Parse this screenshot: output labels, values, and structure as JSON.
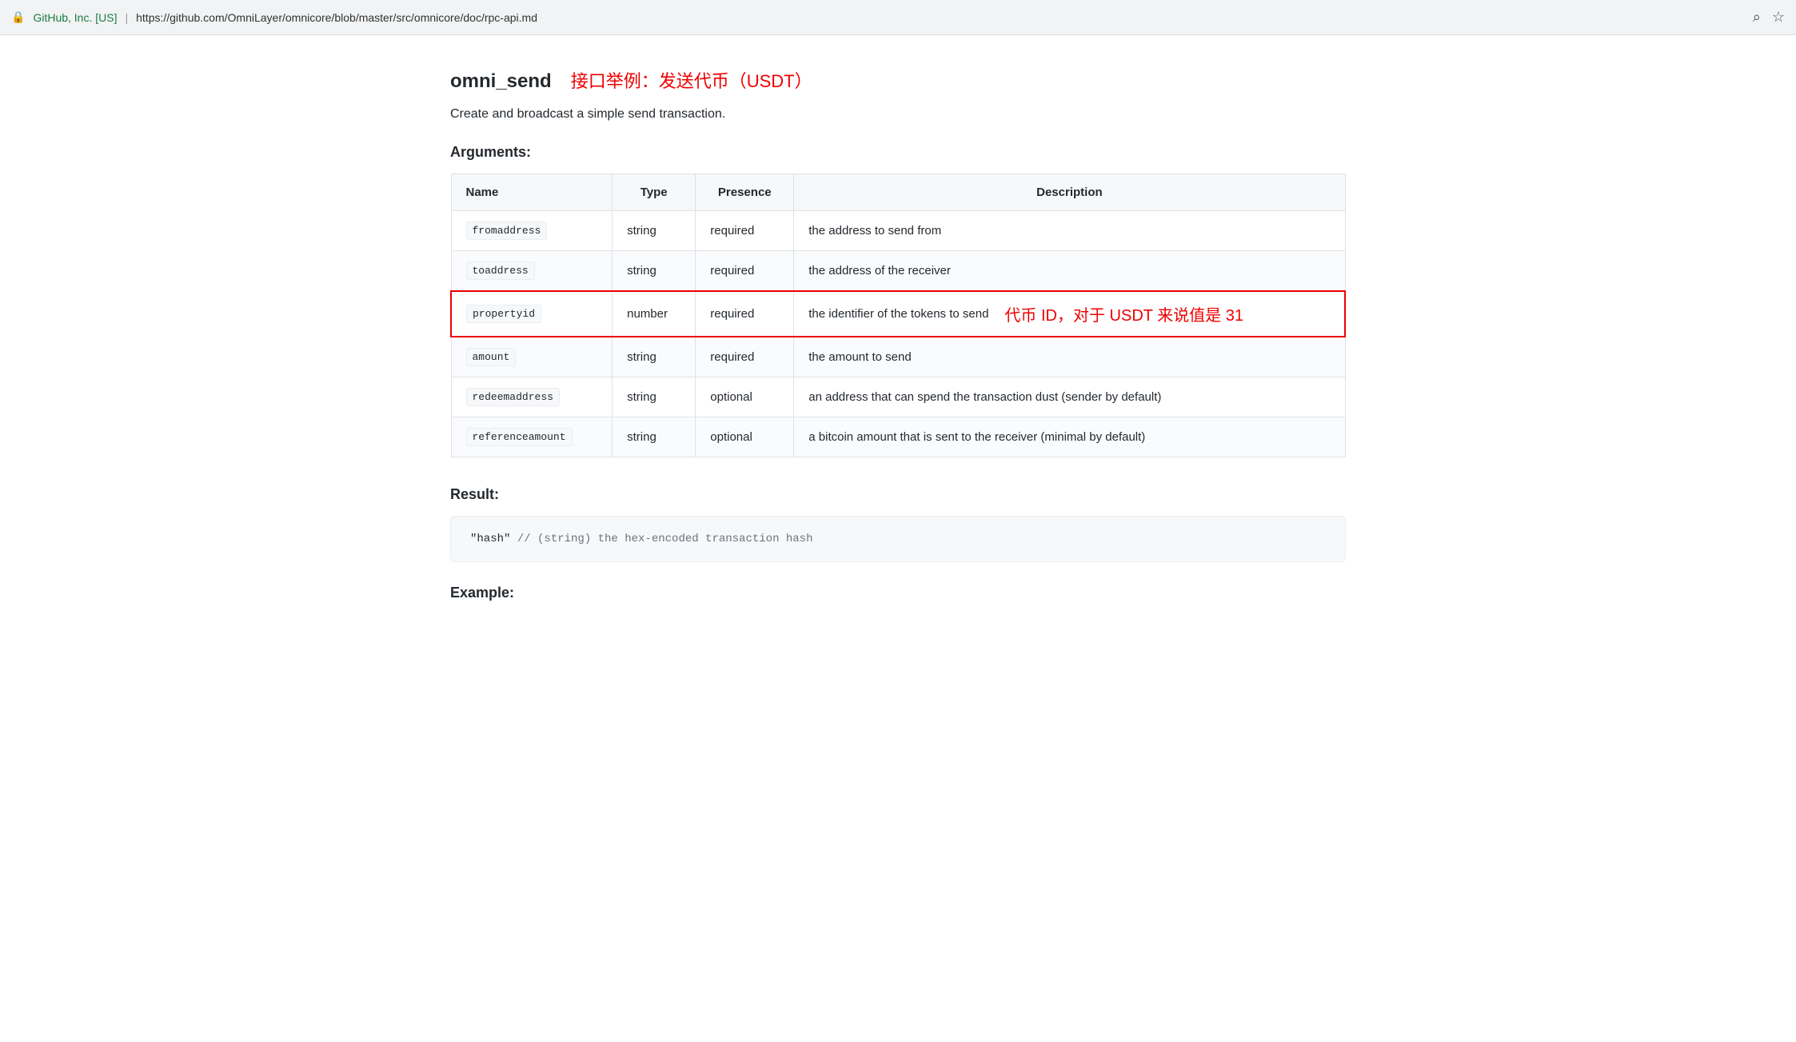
{
  "browser": {
    "lock_icon": "🔒",
    "site_info": "GitHub, Inc. [US]",
    "separator": "|",
    "url": "https://github.com/OmniLayer/omnicore/blob/master/src/omnicore/doc/rpc-api.md",
    "search_icon": "⌕",
    "star_icon": "☆"
  },
  "page": {
    "api_name": "omni_send",
    "chinese_subtitle": "接口举例：发送代币（USDT）",
    "description": "Create and broadcast a simple send transaction.",
    "arguments_label": "Arguments:",
    "table": {
      "headers": [
        "Name",
        "Type",
        "Presence",
        "Description"
      ],
      "rows": [
        {
          "name": "fromaddress",
          "type": "string",
          "presence": "required",
          "description": "the address to send from",
          "highlighted": false
        },
        {
          "name": "toaddress",
          "type": "string",
          "presence": "required",
          "description": "the address of the receiver",
          "highlighted": false
        },
        {
          "name": "propertyid",
          "type": "number",
          "presence": "required",
          "description": "the identifier of the tokens to send",
          "highlighted": true,
          "annotation": "代币 ID，对于 USDT 来说值是 31"
        },
        {
          "name": "amount",
          "type": "string",
          "presence": "required",
          "description": "the amount to send",
          "highlighted": false
        },
        {
          "name": "redeemaddress",
          "type": "string",
          "presence": "optional",
          "description": "an address that can spend the transaction dust (sender by default)",
          "highlighted": false
        },
        {
          "name": "referenceamount",
          "type": "string",
          "presence": "optional",
          "description": "a bitcoin amount that is sent to the receiver (minimal by default)",
          "highlighted": false
        }
      ]
    },
    "result_label": "Result:",
    "code_block": "\"hash\"  // (string) the hex-encoded transaction hash",
    "example_label": "Example:"
  }
}
